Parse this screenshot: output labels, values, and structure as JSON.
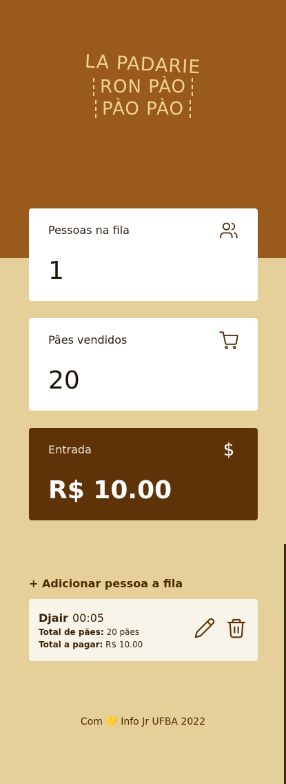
{
  "logo": {
    "line1": "LA PADARIE",
    "line2": "RON PÀO",
    "line3": "PÀO PÀO"
  },
  "stats": [
    {
      "label": "Pessoas na fila",
      "value": "1",
      "icon": "users-icon"
    },
    {
      "label": "Pães vendidos",
      "value": "20",
      "icon": "cart-icon"
    },
    {
      "label": "Entrada",
      "value": "R$ 10.00",
      "icon": "dollar-icon",
      "icon_glyph": "$"
    }
  ],
  "queue": {
    "add_label": "+ Adicionar pessoa a fila",
    "items": [
      {
        "name": "Djair",
        "time": "00:05",
        "total_paes_label": "Total de pães:",
        "total_paes_value": "20 pães",
        "total_pagar_label": "Total a pagar:",
        "total_pagar_value": "R$ 10.00"
      }
    ]
  },
  "footer": {
    "prefix": "Com",
    "heart": "💛",
    "suffix": "Info Jr UFBA 2022"
  },
  "colors": {
    "hero": "#9a5a1c",
    "background": "#e6d09a",
    "dark_card": "#5e3308",
    "accent_text": "#4d2a06"
  }
}
